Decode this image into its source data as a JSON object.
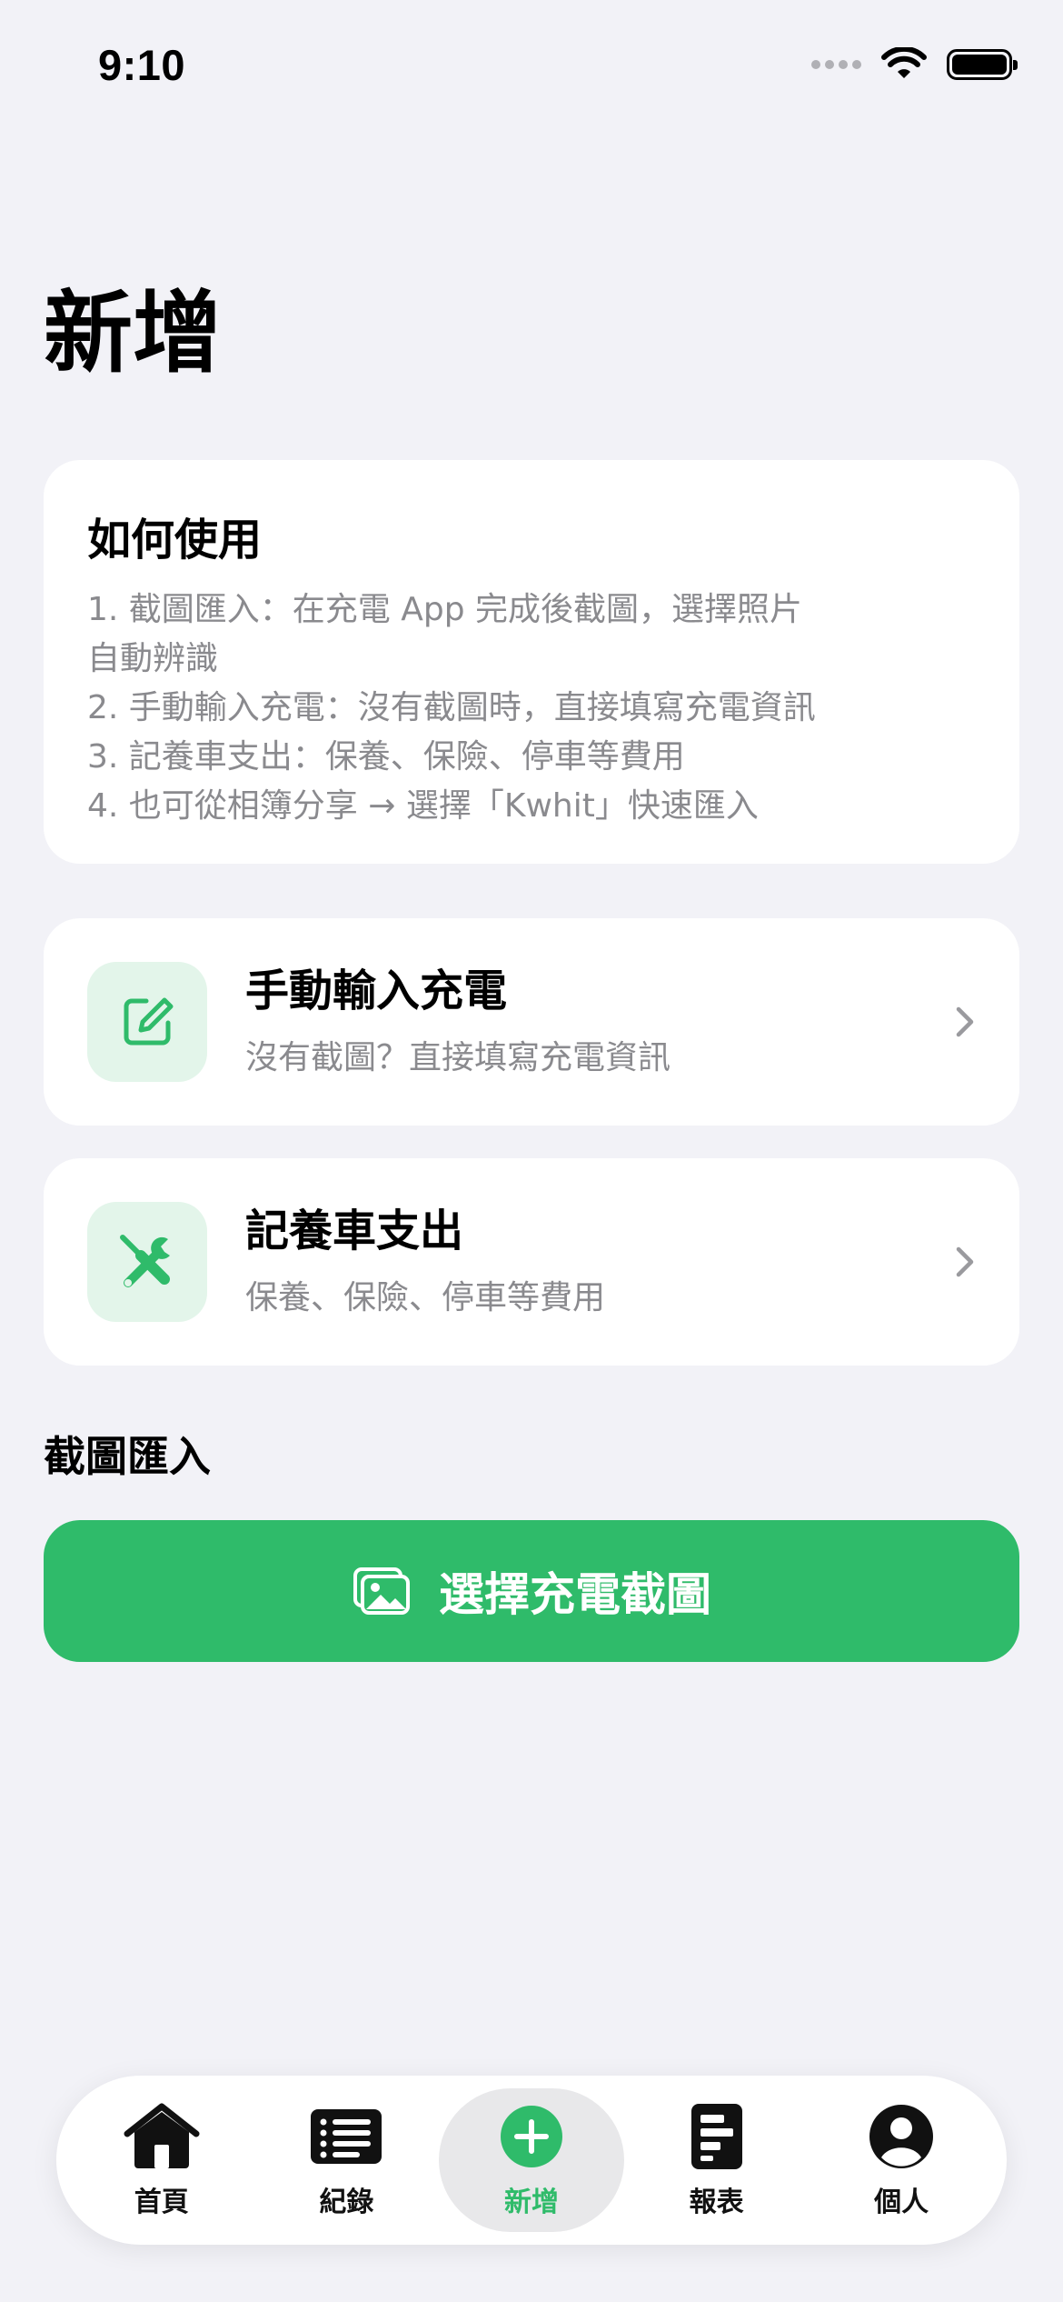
{
  "status": {
    "time": "9:10"
  },
  "page": {
    "title": "新增"
  },
  "howto": {
    "title": "如何使用",
    "lines": [
      "1. 截圖匯入：在充電 App 完成後截圖，選擇照片",
      "自動辨識",
      "2. 手動輸入充電：沒有截圖時，直接填寫充電資訊",
      "3. 記養車支出：保養、保險、停車等費用",
      "4. 也可從相簿分享 → 選擇「Kwhit」快速匯入"
    ]
  },
  "actions": [
    {
      "title": "手動輸入充電",
      "subtitle": "沒有截圖？直接填寫充電資訊",
      "icon": "edit-icon"
    },
    {
      "title": "記養車支出",
      "subtitle": "保養、保險、停車等費用",
      "icon": "tools-icon"
    }
  ],
  "import": {
    "section_label": "截圖匯入",
    "button_label": "選擇充電截圖",
    "icon": "photos-icon"
  },
  "tabbar": {
    "tabs": [
      {
        "label": "首頁",
        "icon": "house-icon"
      },
      {
        "label": "紀錄",
        "icon": "list-icon"
      },
      {
        "label": "新增",
        "icon": "plus-circle-icon",
        "active": true
      },
      {
        "label": "報表",
        "icon": "report-icon"
      },
      {
        "label": "個人",
        "icon": "person-icon"
      }
    ]
  },
  "colors": {
    "accent": "#2fbb6a",
    "accent_soft": "#e3f5ea",
    "background": "#f2f2f7",
    "secondary_text": "#8a8a8e"
  }
}
